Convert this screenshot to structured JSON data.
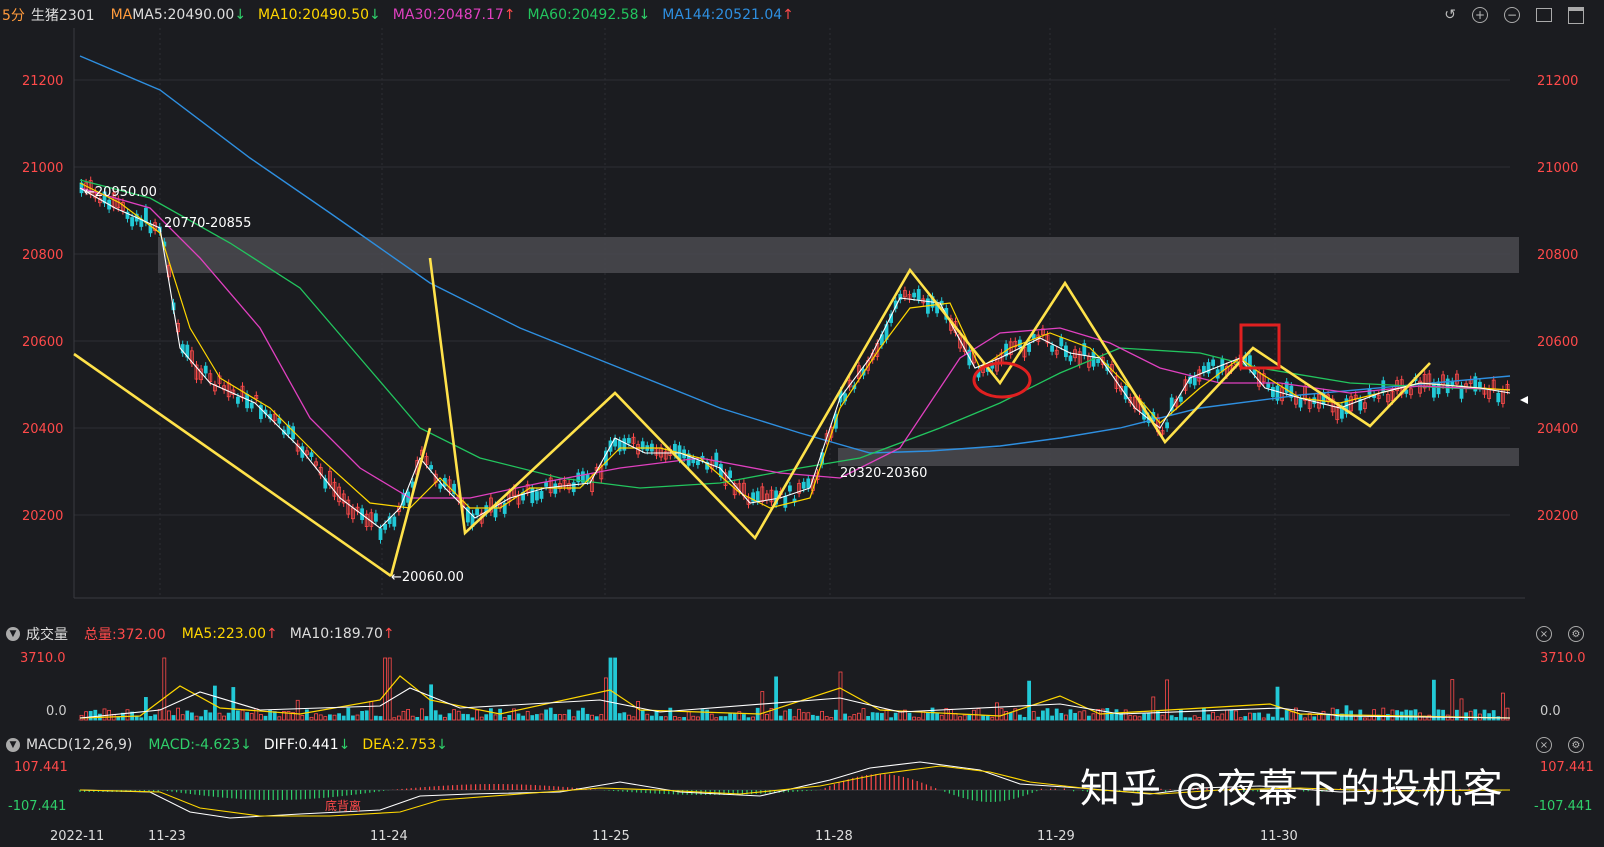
{
  "top": {
    "period": "5分",
    "symbol": "生猪2301",
    "ma_label": "MA",
    "ma5": "MA5:20490.00",
    "ma10": "MA10:20490.50",
    "ma30": "MA30:20487.17",
    "ma60": "MA60:20492.58",
    "ma144": "MA144:20521.04"
  },
  "price_axis": [
    "21200",
    "21000",
    "20800",
    "20600",
    "20400",
    "20200"
  ],
  "annotations": {
    "high": "20950.00",
    "zone_top": "20770-20855",
    "zone_bottom": "20320-20360",
    "low": "20060.00"
  },
  "volume": {
    "title": "成交量",
    "total": "总量:372.00",
    "ma5": "MA5:223.00",
    "ma10": "MA10:189.70",
    "axis_top": "3710.0",
    "axis_zero": "0.0"
  },
  "macd": {
    "title": "MACD(12,26,9)",
    "macd": "MACD:-4.623",
    "diff": "DIFF:0.441",
    "dea": "DEA:2.753",
    "axis_top": "107.441",
    "axis_bottom": "-107.441",
    "divergence_label": "底背离"
  },
  "time_axis": [
    "2022-11",
    "11-23",
    "11-24",
    "11-25",
    "11-28",
    "11-29",
    "11-30"
  ],
  "watermark": "知乎 @夜幕下的投机客",
  "colors": {
    "ma5": "#ffffff",
    "ma10": "#ffd700",
    "ma30": "#e040c0",
    "ma60": "#22c55e",
    "ma144": "#2e8fe0",
    "zigzag": "#ffe24a",
    "up": "#ff4a4a",
    "down": "#22c9d6"
  }
}
